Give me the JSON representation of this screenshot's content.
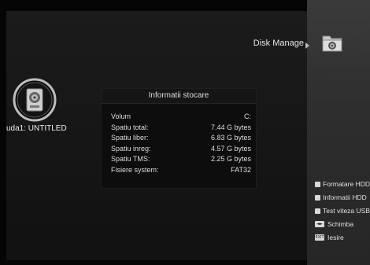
{
  "header": {
    "title": "Disk Manage"
  },
  "disk": {
    "label": "uda1: UNTITLED"
  },
  "info": {
    "heading": "Informatii stocare",
    "rows": [
      {
        "key": "Volum",
        "value": "C:"
      },
      {
        "key": "Spatiu total:",
        "value": "7.44 G bytes"
      },
      {
        "key": "Spatiu liber:",
        "value": "6.83 G bytes"
      },
      {
        "key": "Spatiu inreg:",
        "value": "4.57 G bytes"
      },
      {
        "key": "Spatiu TMS:",
        "value": "2.25 G bytes"
      },
      {
        "key": "Fisiere system:",
        "value": "FAT32"
      }
    ]
  },
  "menu": {
    "items": [
      {
        "label": "Formatare HDD",
        "icon": "square-bullet-icon"
      },
      {
        "label": "Informatii HDD",
        "icon": "square-bullet-icon"
      },
      {
        "label": "Test viteza USB",
        "icon": "square-bullet-icon"
      },
      {
        "label": "Schimba",
        "icon": "left-right-key-icon",
        "key": "◄►"
      },
      {
        "label": "Iesire",
        "icon": "exit-key-icon",
        "key": "EXIT"
      }
    ]
  }
}
